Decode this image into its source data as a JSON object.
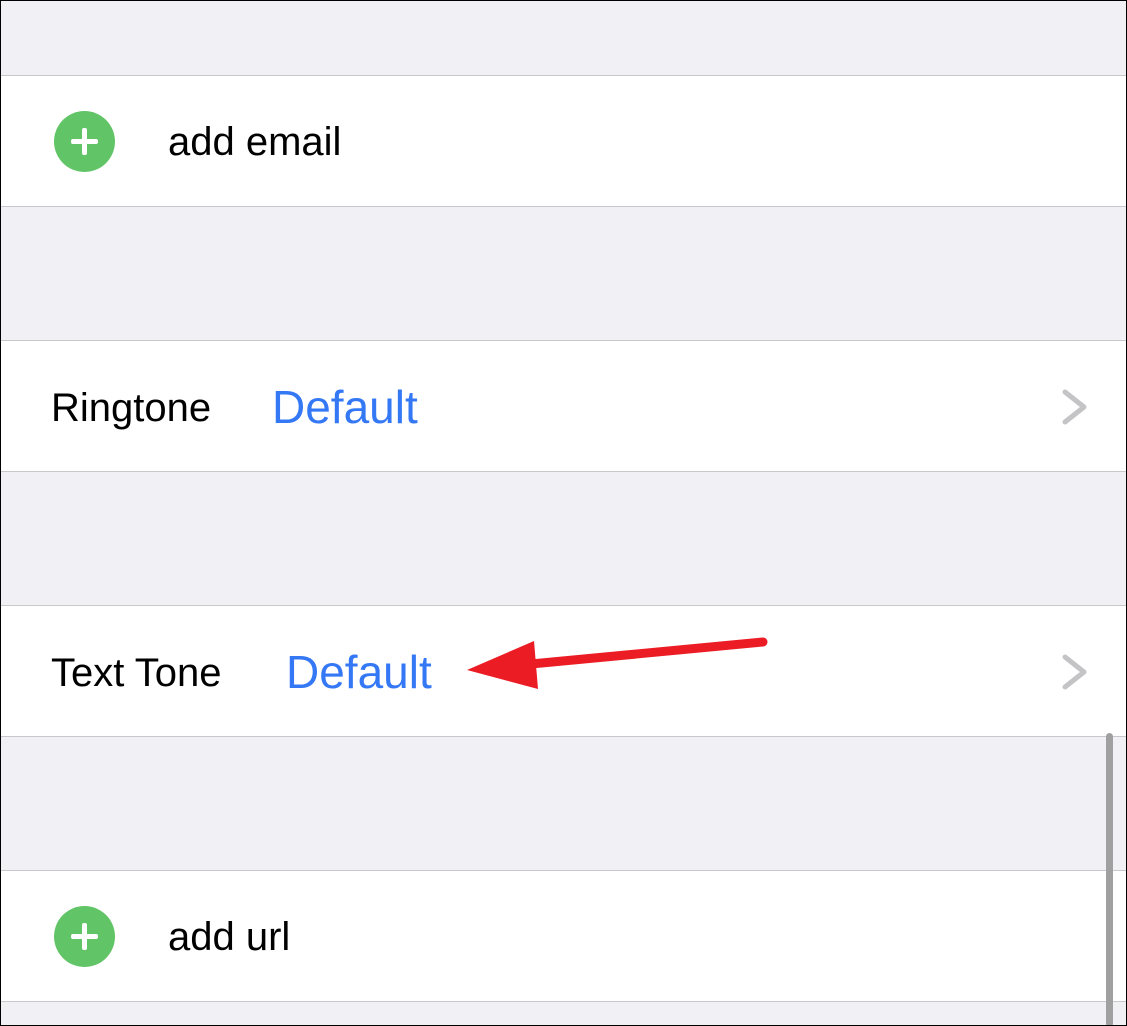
{
  "rows": {
    "add_email": {
      "label": "add email",
      "icon": "plus-circle-icon"
    },
    "ringtone": {
      "label": "Ringtone",
      "value": "Default",
      "icon": "chevron-right-icon"
    },
    "text_tone": {
      "label": "Text Tone",
      "value": "Default",
      "icon": "chevron-right-icon"
    },
    "add_url": {
      "label": "add url",
      "icon": "plus-circle-icon"
    }
  },
  "colors": {
    "accent": "#3478f6",
    "add_green": "#61c466",
    "annotation_arrow": "#ec1c24",
    "chevron": "#c4c4c7",
    "group_background": "#f0f0f5"
  },
  "annotation": {
    "type": "arrow",
    "points_to": "text_tone.value"
  }
}
